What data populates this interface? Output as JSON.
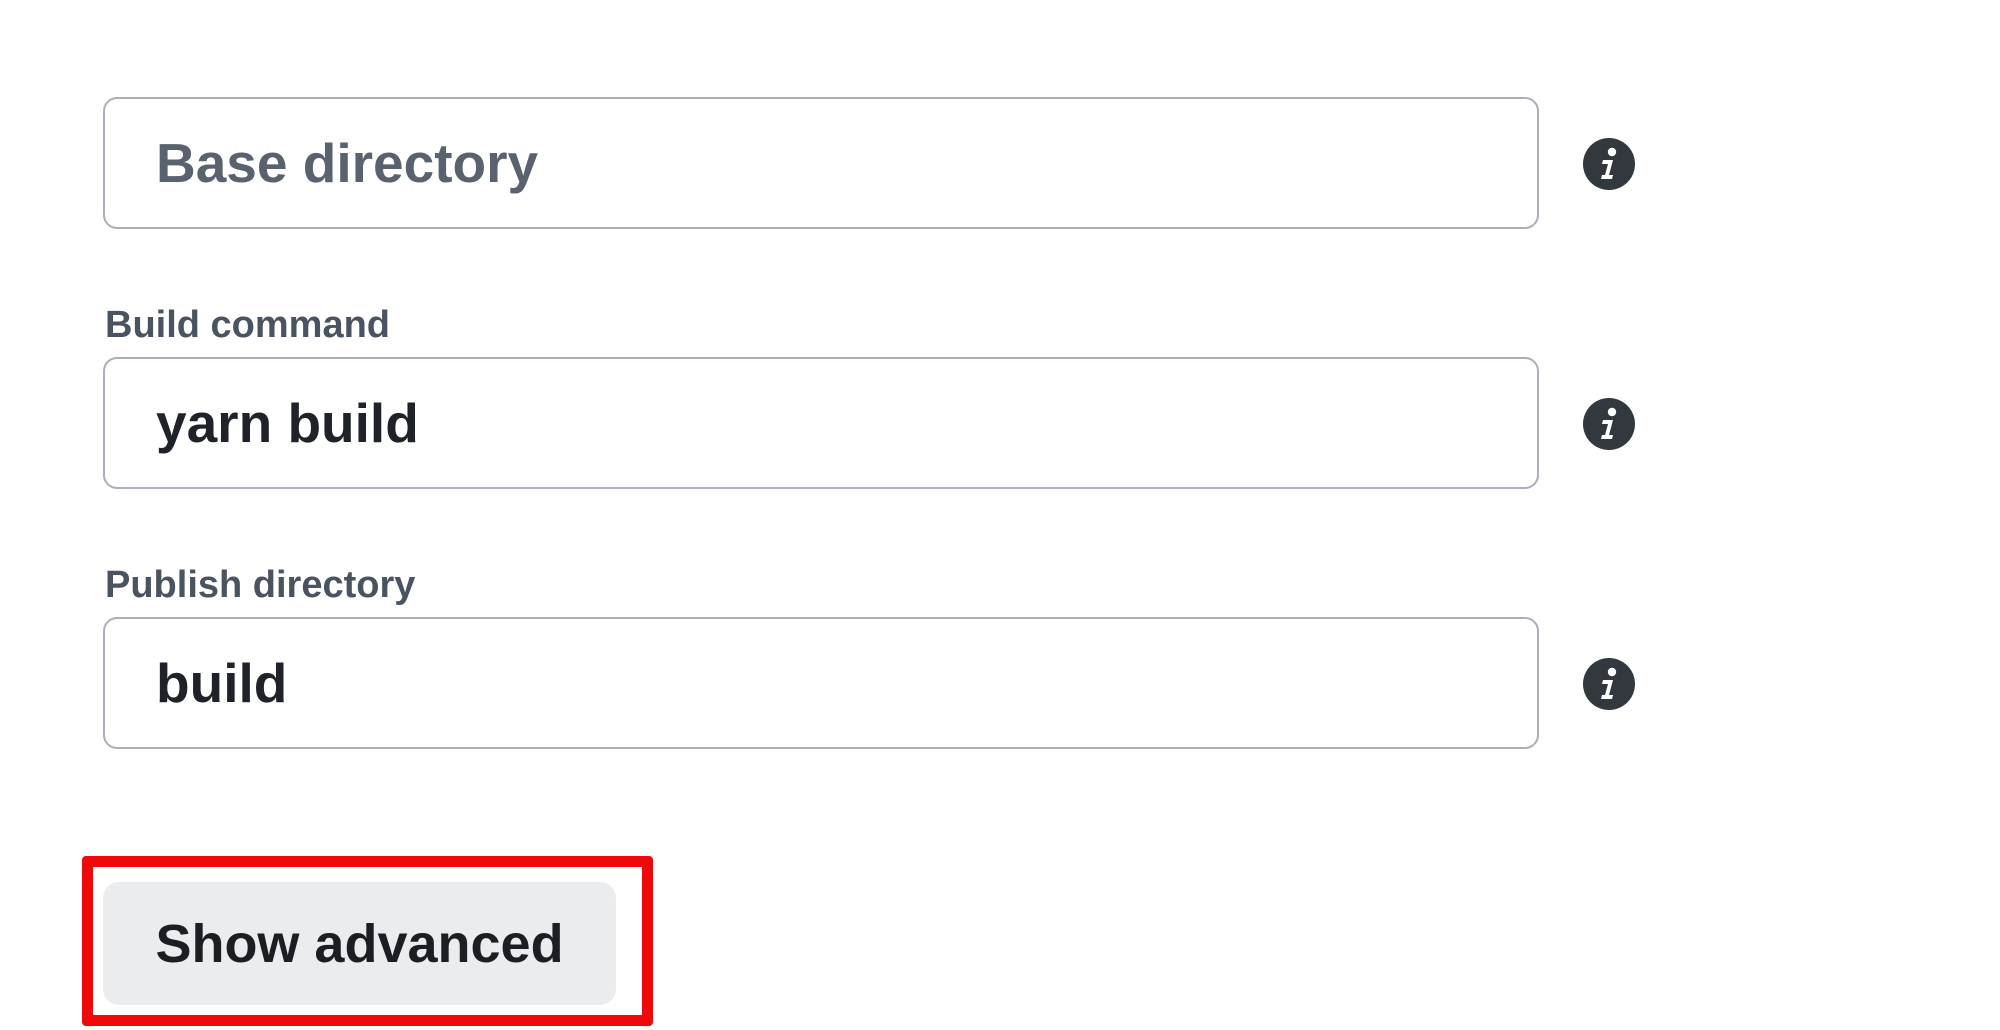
{
  "form": {
    "base_directory": {
      "label": "",
      "value": "",
      "placeholder": "Base directory",
      "info_icon": "info-icon"
    },
    "build_command": {
      "label": "Build command",
      "value": "yarn build",
      "placeholder": "",
      "info_icon": "info-icon"
    },
    "publish_directory": {
      "label": "Publish directory",
      "value": "build",
      "placeholder": "",
      "info_icon": "info-icon"
    }
  },
  "actions": {
    "show_advanced_label": "Show advanced"
  },
  "colors": {
    "input_border": "#a9b0ba",
    "label_text": "#4a5360",
    "icon_fill": "#33383f",
    "button_bg": "#ebecee",
    "highlight": "#ee0a0a"
  }
}
